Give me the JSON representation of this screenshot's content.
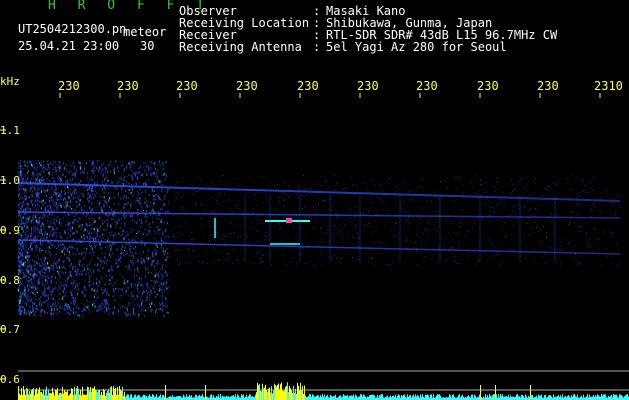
{
  "header": {
    "program_title": "H R O F F T",
    "filename": "UT2504212300.pn",
    "file_type": "meteor",
    "datetime": "25.04.21 23:00",
    "interval": "30"
  },
  "info": [
    {
      "label": "Observer",
      "value": "Masaki Kano"
    },
    {
      "label": "Receiving Location",
      "value": "Shibukawa, Gunma, Japan"
    },
    {
      "label": "Receiver",
      "value": "RTL-SDR SDR# 43dB L15 96.7MHz CW"
    },
    {
      "label": "Receiving Antenna",
      "value": "5el Yagi Az 280 for Seoul"
    }
  ],
  "axis": {
    "y_unit": "kHz",
    "x_ticks": [
      "230",
      "230",
      "230",
      "230",
      "230",
      "230",
      "230",
      "230",
      "230",
      "2310"
    ],
    "y_ticks": [
      "1.1",
      "1.0",
      "0.9",
      "0.8",
      "0.7",
      "0.6"
    ]
  },
  "colors": {
    "label_green": "#34c934",
    "axis_yellow": "#ffff55",
    "background": "#000000",
    "signal_blue": "#3355ff",
    "signal_cyan": "#33ffff",
    "intensity_yellow": "#ffff00"
  }
}
